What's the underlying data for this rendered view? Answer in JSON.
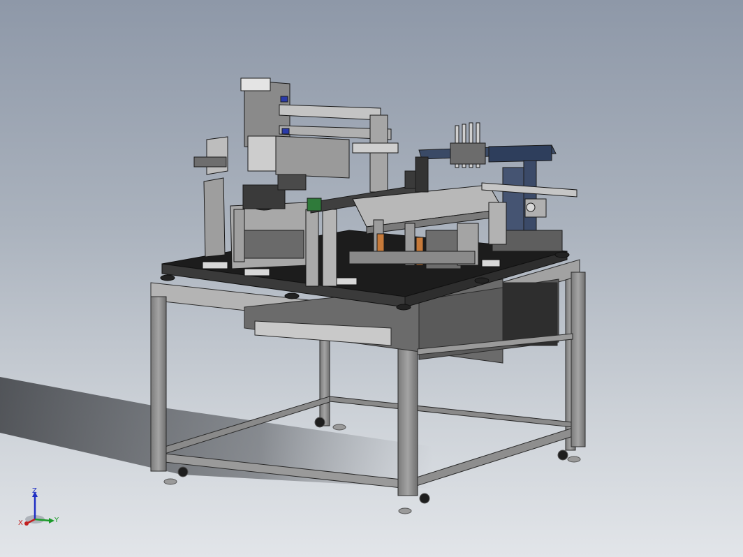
{
  "viewport": {
    "model_name": "",
    "triad": {
      "z_label": "Z",
      "y_label": "Y",
      "x_label": "X",
      "colors": {
        "z": "#1f2fc4",
        "y": "#1c9a2a",
        "x": "#c21f1f"
      }
    }
  },
  "colors": {
    "background_top": "#8e98a8",
    "background_bottom": "#e2e5e9",
    "frame_metal": "#8c8c8c",
    "dark_metal": "#3a3a3a",
    "accent_blue": "#2a3aa8"
  }
}
